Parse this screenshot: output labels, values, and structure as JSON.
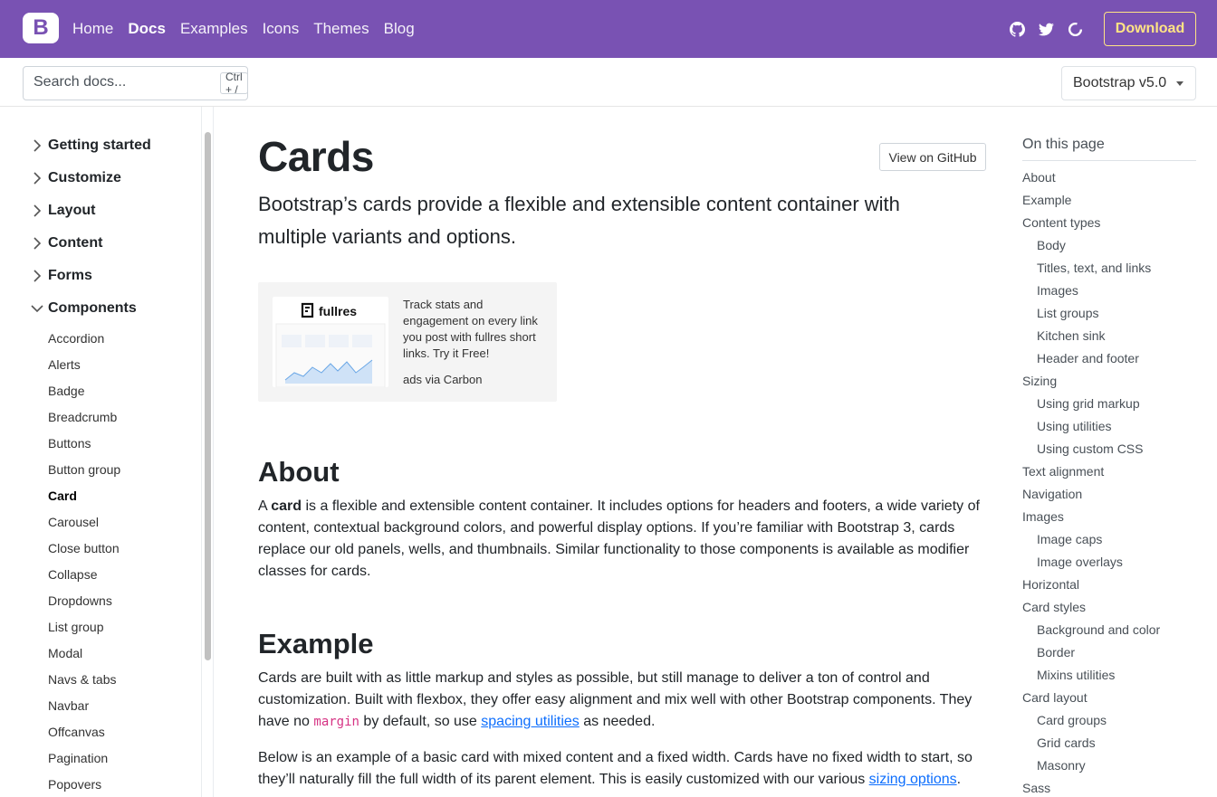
{
  "topnav": {
    "brand": "B",
    "links": [
      "Home",
      "Docs",
      "Examples",
      "Icons",
      "Themes",
      "Blog"
    ],
    "active": "Docs",
    "icons": [
      "github-icon",
      "twitter-icon",
      "opencollective-icon"
    ],
    "download_label": "Download",
    "colors": {
      "bg": "#7952b3",
      "download": "#ffe484"
    }
  },
  "subnav": {
    "search_placeholder": "Search docs...",
    "shortcut": "Ctrl + /",
    "version_label": "Bootstrap v5.0"
  },
  "sidebar": {
    "sections": [
      "Getting started",
      "Customize",
      "Layout",
      "Content",
      "Forms",
      "Components"
    ],
    "expanded": "Components",
    "items": [
      "Accordion",
      "Alerts",
      "Badge",
      "Breadcrumb",
      "Buttons",
      "Button group",
      "Card",
      "Carousel",
      "Close button",
      "Collapse",
      "Dropdowns",
      "List group",
      "Modal",
      "Navs & tabs",
      "Navbar",
      "Offcanvas",
      "Pagination",
      "Popovers"
    ],
    "current": "Card"
  },
  "main": {
    "title": "Cards",
    "github_button": "View on GitHub",
    "lead_1": "Bootstrap’s cards provide a flexible and extensible content container with",
    "lead_2": "multiple variants and options.",
    "ad": {
      "logo": "fullres",
      "text": "Track stats and engagement on every link you post with fullres short links. Try it Free!",
      "via": "ads via Carbon"
    },
    "about_heading": "About",
    "about_pre": "A ",
    "about_bold": "card",
    "about_rest": " is a flexible and extensible content container. It includes options for headers and footers, a wide variety of content, contextual background colors, and powerful display options. If you’re familiar with Bootstrap 3, cards replace our old panels, wells, and thumbnails. Similar functionality to those components is available as modifier classes for cards.",
    "example_heading": "Example",
    "example_p1_a": "Cards are built with as little markup and styles as possible, but still manage to deliver a ton of control and customization. Built with flexbox, they offer easy alignment and mix well with other Bootstrap components. They have no ",
    "example_p1_code": "margin",
    "example_p1_b": " by default, so use ",
    "example_p1_link": "spacing utilities",
    "example_p1_c": " as needed.",
    "example_p2_a": "Below is an example of a basic card with mixed content and a fixed width. Cards have no fixed width to start, so they’ll naturally fill the full width of its parent element. This is easily customized with our various ",
    "example_p2_link": "sizing options",
    "example_p2_b": "."
  },
  "toc": {
    "title": "On this page",
    "items": [
      {
        "label": "About",
        "level": 1
      },
      {
        "label": "Example",
        "level": 1
      },
      {
        "label": "Content types",
        "level": 1
      },
      {
        "label": "Body",
        "level": 2
      },
      {
        "label": "Titles, text, and links",
        "level": 2
      },
      {
        "label": "Images",
        "level": 2
      },
      {
        "label": "List groups",
        "level": 2
      },
      {
        "label": "Kitchen sink",
        "level": 2
      },
      {
        "label": "Header and footer",
        "level": 2
      },
      {
        "label": "Sizing",
        "level": 1
      },
      {
        "label": "Using grid markup",
        "level": 2
      },
      {
        "label": "Using utilities",
        "level": 2
      },
      {
        "label": "Using custom CSS",
        "level": 2
      },
      {
        "label": "Text alignment",
        "level": 1
      },
      {
        "label": "Navigation",
        "level": 1
      },
      {
        "label": "Images",
        "level": 1
      },
      {
        "label": "Image caps",
        "level": 2
      },
      {
        "label": "Image overlays",
        "level": 2
      },
      {
        "label": "Horizontal",
        "level": 1
      },
      {
        "label": "Card styles",
        "level": 1
      },
      {
        "label": "Background and color",
        "level": 2
      },
      {
        "label": "Border",
        "level": 2
      },
      {
        "label": "Mixins utilities",
        "level": 2
      },
      {
        "label": "Card layout",
        "level": 1
      },
      {
        "label": "Card groups",
        "level": 2
      },
      {
        "label": "Grid cards",
        "level": 2
      },
      {
        "label": "Masonry",
        "level": 2
      },
      {
        "label": "Sass",
        "level": 1
      }
    ]
  }
}
